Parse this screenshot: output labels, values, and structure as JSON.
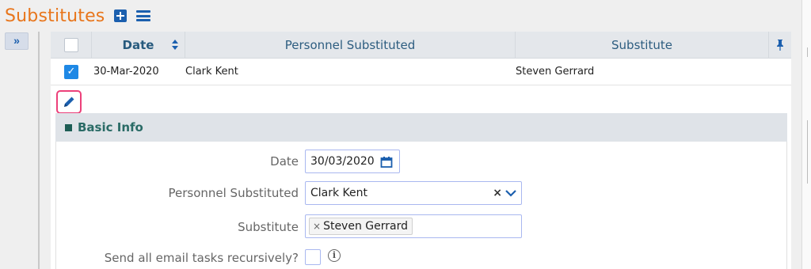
{
  "page": {
    "title": "Substitutes"
  },
  "grid": {
    "headers": {
      "date": "Date",
      "personnel": "Personnel Substituted",
      "substitute": "Substitute"
    },
    "rows": [
      {
        "checked": "✓",
        "date": "30-Mar-2020",
        "personnel": "Clark Kent",
        "substitute": "Steven Gerrard"
      }
    ]
  },
  "form": {
    "section_title": "Basic Info",
    "date_label": "Date",
    "date_value": "30/03/2020",
    "personnel_label": "Personnel Substituted",
    "personnel_value": "Clark Kent",
    "personnel_clear": "×",
    "substitute_label": "Substitute",
    "substitute_tag": "Steven Gerrard",
    "substitute_tag_remove": "×",
    "send_label": "Send all email tasks recursively?",
    "info_glyph": "i"
  },
  "icons": {
    "expand": "»",
    "pin": "📌"
  },
  "colors": {
    "title": "#e8761c",
    "primary": "#1b5fae",
    "checkbox": "#1e88e5",
    "edit_border": "#ec407a",
    "section_text": "#2a6b66"
  }
}
